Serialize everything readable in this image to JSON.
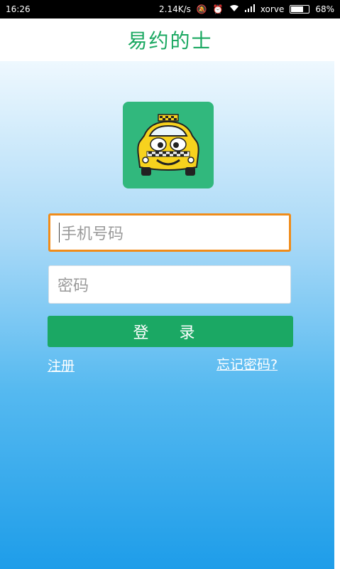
{
  "status_bar": {
    "time": "16:26",
    "net_speed": "2.14K/s",
    "carrier": "xorve",
    "battery": "68%",
    "battery_level": 0.68,
    "icons": [
      "mute-icon",
      "alarm-icon",
      "wifi-icon",
      "signal-icon",
      "battery-icon"
    ]
  },
  "app": {
    "title": "易约的士"
  },
  "logo": {
    "icon": "taxi-icon",
    "bg_color": "#31b87d"
  },
  "form": {
    "phone_placeholder": "手机号码",
    "password_placeholder": "密码",
    "login_label": "登 录",
    "register_label": "注册",
    "forgot_label": "忘记密码?"
  },
  "colors": {
    "accent_green": "#1ba864",
    "focus_orange": "#f08c1a",
    "bg_gradient_top": "#eef8fe",
    "bg_gradient_bottom": "#1e9de9"
  }
}
